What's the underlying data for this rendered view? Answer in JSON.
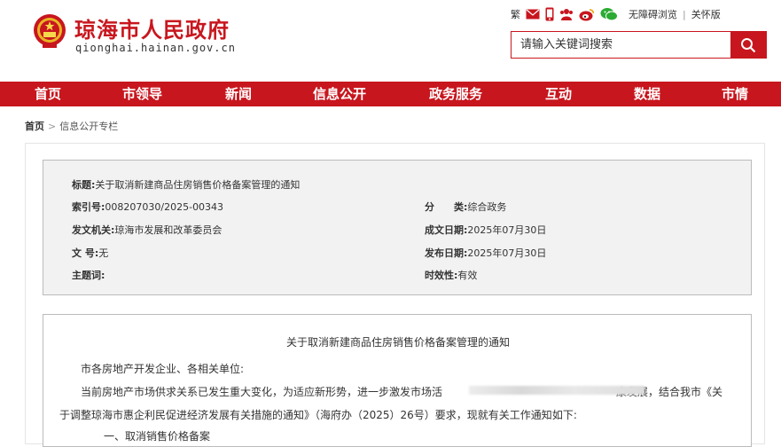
{
  "site": {
    "title": "琼海市人民政府",
    "domain": "qionghai.hainan.gov.cn"
  },
  "toplinks": {
    "traditional": "繁",
    "icons": [
      "mail-icon",
      "mobile-icon",
      "people-icon",
      "weibo-icon",
      "wechat-icon"
    ],
    "accessible": "无障碍浏览",
    "care": "关怀版"
  },
  "search": {
    "placeholder": "请输入关键词搜索"
  },
  "nav": {
    "items": [
      "首页",
      "市领导",
      "新闻",
      "信息公开",
      "政务服务",
      "互动",
      "数据",
      "市情"
    ]
  },
  "breadcrumb": {
    "home": "首页",
    "current": "信息公开专栏"
  },
  "meta": {
    "title_label": "标题:",
    "title_value": "关于取消新建商品住房销售价格备案管理的通知",
    "index_label": "索引号:",
    "index_value": "008207030/2025-00343",
    "category_label": "分　　类:",
    "category_value": "综合政务",
    "issuer_label": "发文机关:",
    "issuer_value": "琼海市发展和改革委员会",
    "written_label": "成文日期:",
    "written_value": "2025年07月30日",
    "docno_label": "文  号:",
    "docno_value": "无",
    "publish_label": "发布日期:",
    "publish_value": "2025年07月30日",
    "subject_label": "主题词:",
    "subject_value": "",
    "validity_label": "时效性:",
    "validity_value": "有效"
  },
  "doc": {
    "title": "关于取消新建商品住房销售价格备案管理的通知",
    "salutation": "市各房地产开发企业、各相关单位:",
    "para1_a": "当前房地产市场供求关系已发生重大变化，为适应新形势，进一步激发市场活",
    "para1_b": "康发展，结合我市《关",
    "para2": "于调整琼海市惠企利民促进经济发展有关措施的通知》（海府办（2025）26号）要求，现就有关工作通知如下:",
    "para3": "一、取消销售价格备案"
  },
  "colors": {
    "brand": "#c8161e"
  }
}
